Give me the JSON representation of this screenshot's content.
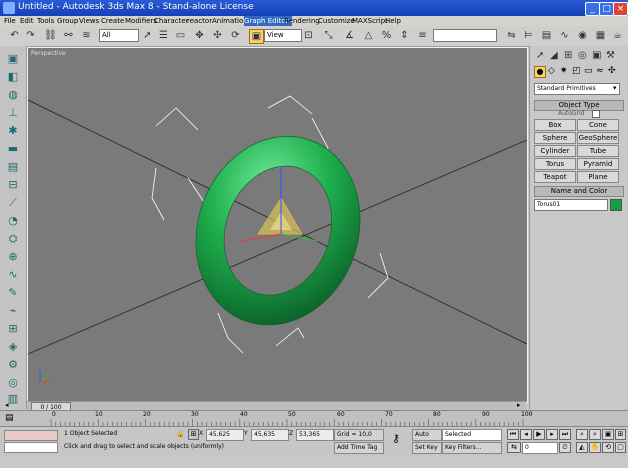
{
  "window": {
    "title": "Untitled   - Autodesk 3ds Max 8  - Stand-alone License"
  },
  "window_buttons": {
    "minimize": "_",
    "maximize": "□",
    "close": "×"
  },
  "menu": [
    "File",
    "Edit",
    "Tools",
    "Group",
    "Views",
    "Create",
    "Modifiers",
    "Character",
    "reactor",
    "Animation",
    "Graph Editors",
    "Rendering",
    "Customize",
    "MAXScript",
    "Help"
  ],
  "menu_highlighted": "Graph Editors",
  "toolbar": {
    "selection_filter": "All",
    "ref_coord": "View"
  },
  "viewport": {
    "label": "Perspective"
  },
  "command_panel": {
    "category_dropdown": "Standard Primitives",
    "object_type_title": "Object Type",
    "autogrid_label": "AutoGrid",
    "buttons": [
      "Box",
      "Cone",
      "Sphere",
      "GeoSphere",
      "Cylinder",
      "Tube",
      "Torus",
      "Pyramid",
      "Teapot",
      "Plane"
    ],
    "name_color_title": "Name and Color",
    "object_name": "Torus01",
    "object_color": "#0fa043"
  },
  "time_slider": {
    "frame_text": "0 / 100"
  },
  "track_ticks": [
    "0",
    "10",
    "20",
    "30",
    "40",
    "50",
    "60",
    "70",
    "80",
    "90",
    "100"
  ],
  "status": {
    "selection_text": "1 Object Selected",
    "prompt_text": "Click and drag to select and scale objects (uniformly)",
    "x_label": "X",
    "x_value": "45,625",
    "y_label": "Y",
    "y_value": "45,635",
    "z_label": "Z",
    "z_value": "53,365",
    "grid_text": "Grid = 10,0",
    "add_time_tag": "Add Time Tag",
    "auto_key": "Auto Key",
    "set_key": "Set Key",
    "key_mode": "Selected",
    "key_filters": "Key Filters...",
    "current_frame": "0"
  },
  "colors": {
    "torus": "#15a346",
    "viewport_bg": "#7a7a7a",
    "title_bar": "#1f4fc8",
    "gizmo": "#e0c050"
  }
}
